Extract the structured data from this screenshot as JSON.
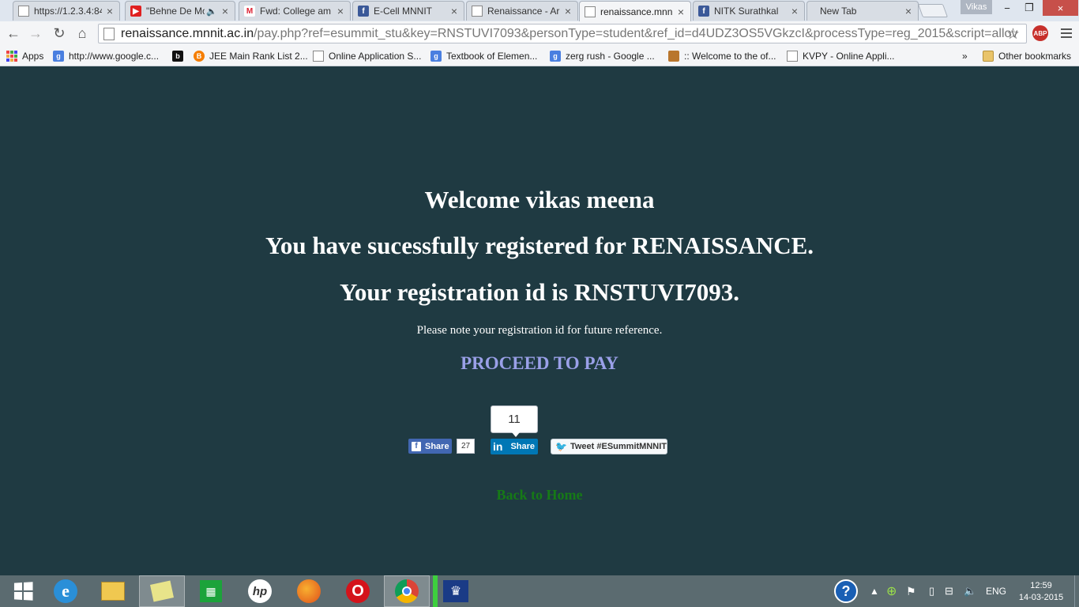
{
  "browser": {
    "tabs": [
      {
        "title": "https://1.2.3.4:84",
        "favicon": "page-icon",
        "active": false
      },
      {
        "title": "\"Behne De Mo",
        "favicon": "youtube-icon",
        "active": false,
        "audio": true
      },
      {
        "title": "Fwd: College am",
        "favicon": "gmail-icon",
        "active": false
      },
      {
        "title": "E-Cell MNNIT",
        "favicon": "facebook-icon",
        "active": false
      },
      {
        "title": "Renaissance - Ar",
        "favicon": "page-icon",
        "active": false
      },
      {
        "title": "renaissance.mnn",
        "favicon": "page-icon",
        "active": true
      },
      {
        "title": "NITK Surathkal",
        "favicon": "facebook-icon",
        "active": false
      },
      {
        "title": "New Tab",
        "favicon": "none",
        "active": false
      }
    ],
    "close_glyph": "×",
    "profile_name": "Vikas",
    "address": {
      "host": "renaissance.mnnit.ac.in",
      "path": "/pay.php?ref=esummit_stu&key=RNSTUVI7093&personType=student&ref_id=d4UDZ3OS5VGkzcI&processType=reg_2015&script=allov"
    },
    "extension_label": "ABP",
    "bookmarks": [
      {
        "label": "Apps",
        "icon": "apps-grid-icon"
      },
      {
        "label": "http://www.google.c...",
        "icon": "google-icon"
      },
      {
        "label": "",
        "icon": "b-icon"
      },
      {
        "label": "JEE Main Rank List 2...",
        "icon": "blogger-icon"
      },
      {
        "label": "Online Application S...",
        "icon": "page-icon"
      },
      {
        "label": "Textbook of Elemen...",
        "icon": "google-icon"
      },
      {
        "label": "zerg rush - Google ...",
        "icon": "google-icon"
      },
      {
        "label": ":: Welcome to the of...",
        "icon": "emblem-icon"
      },
      {
        "label": "KVPY - Online Appli...",
        "icon": "page-icon"
      }
    ],
    "bookmarks_overflow": "»",
    "other_bookmarks": "Other bookmarks"
  },
  "page": {
    "welcome": "Welcome vikas meena",
    "registered": "You have sucessfully registered for RENAISSANCE.",
    "registration_id_text": "Your registration id is RNSTUVI7093.",
    "note": "Please note your registration id for future reference.",
    "proceed": "PROCEED TO PAY",
    "back_home": "Back to Home",
    "social": {
      "fb_label": "Share",
      "fb_count": "27",
      "linkedin_count": "11",
      "linkedin_label": "Share",
      "tweet_label": "Tweet #ESummitMNNIT"
    }
  },
  "taskbar": {
    "apps": [
      "windows-start-icon",
      "internet-explorer-icon",
      "file-explorer-icon",
      "sticky-notes-icon",
      "windows-store-icon",
      "hp-icon",
      "firefox-icon",
      "opera-icon",
      "chrome-icon",
      "crown-app-icon"
    ],
    "language": "ENG",
    "time": "12:59",
    "date": "14-03-2015"
  },
  "colors": {
    "page_background": "#1f3a42",
    "proceed_link": "#9aa0e8",
    "back_link": "#167a16",
    "facebook": "#4267b2",
    "linkedin": "#0077b5",
    "taskbar": "#5b6b70"
  }
}
